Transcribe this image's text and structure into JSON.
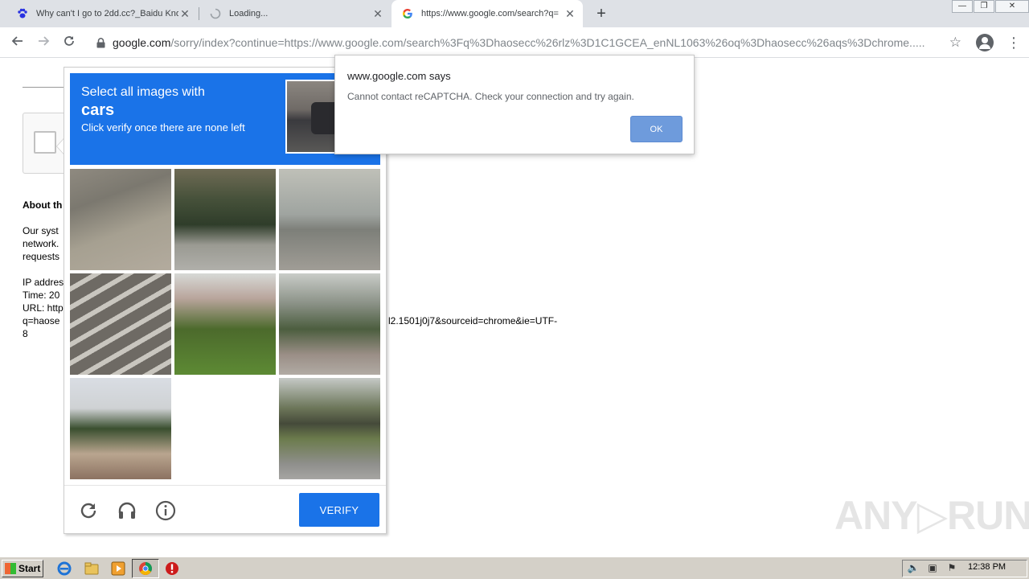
{
  "browser": {
    "tabs": [
      {
        "title": "Why can't I go to 2dd.cc?_Baidu Kno",
        "close": "✕"
      },
      {
        "title": "Loading...",
        "close": "✕"
      },
      {
        "title": "https://www.google.com/search?q=",
        "close": "✕"
      }
    ],
    "new_tab": "+",
    "window_controls": {
      "minimize": "—",
      "restore": "❐",
      "close": "✕"
    },
    "url_host": "google.com",
    "url_rest": "/sorry/index?continue=https://www.google.com/search%3Fq%3Dhaosecc%26rlz%3D1C1GCEA_enNL1063%26oq%3Dhaosecc%26aqs%3Dchrome....."
  },
  "page": {
    "about_heading": "About th",
    "lines": [
      "Our syst",
      "network.",
      "requests",
      "IP addres",
      "Time: 20",
      "URL: http",
      "q=haose",
      "8"
    ],
    "url_tail": "l2.1501j0j7&sourceid=chrome&ie=UTF-"
  },
  "recaptcha": {
    "line1": "Select all images with",
    "line2": "cars",
    "line3": "Click verify once there are none left",
    "verify_label": "VERIFY"
  },
  "dialog": {
    "title": "www.google.com says",
    "message": "Cannot contact reCAPTCHA. Check your connection and try again.",
    "ok_label": "OK"
  },
  "watermark": "ANY▷RUN",
  "taskbar": {
    "start_label": "Start",
    "clock": "12:38 PM"
  },
  "colors": {
    "accent": "#1a73e8",
    "dialog_ok": "#6e9bdc"
  }
}
